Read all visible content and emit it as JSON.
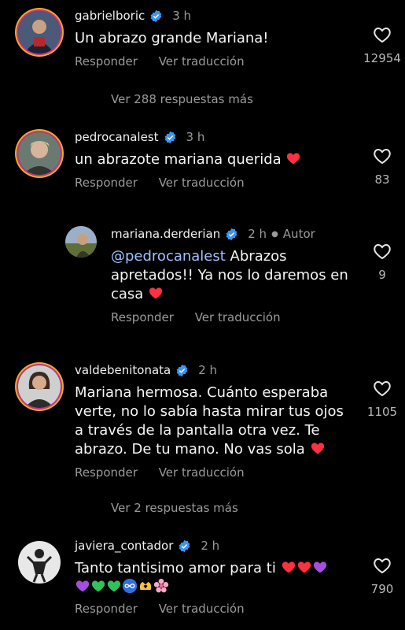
{
  "comments": [
    {
      "username": "gabrielboric",
      "time": "3 h",
      "text": "Un abrazo grande Mariana!",
      "reply": "Responder",
      "translate": "Ver traducción",
      "likes": "12954"
    },
    {
      "username": "pedrocanalest",
      "time": "3 h",
      "text": "un abrazote mariana querida",
      "reply": "Responder",
      "translate": "Ver traducción",
      "likes": "83"
    },
    {
      "username": "mariana.derderian",
      "time": "2 h",
      "author_tag": "Autor",
      "mention": "@pedrocanalest",
      "text_line1": " Abrazos",
      "text_line2": "apretados!! Ya nos lo daremos en",
      "text_line3": "casa",
      "reply": "Responder",
      "translate": "Ver traducción",
      "likes": "9"
    },
    {
      "username": "valdebenitonata",
      "time": "2 h",
      "text_line1": "Mariana hermosa. Cuánto esperaba",
      "text_line2": "verte, no lo sabía hasta mirar tus ojos",
      "text_line3": "a través de la pantalla otra vez. Te",
      "text_line4": "abrazo. De tu mano. No vas sola",
      "reply": "Responder",
      "translate": "Ver traducción",
      "likes": "1105"
    },
    {
      "username": "javiera_contador",
      "time": "2 h",
      "text": "Tanto tantisimo amor para ti",
      "reply": "Responder",
      "translate": "Ver traducción",
      "likes": "790"
    }
  ],
  "more_replies_1": "Ver 288 respuestas más",
  "more_replies_2": "Ver 2 respuestas más",
  "colors": {
    "background": "#000000",
    "verified": "#3897f0",
    "mention": "#9fc2ff",
    "heart": "#ff3040"
  }
}
